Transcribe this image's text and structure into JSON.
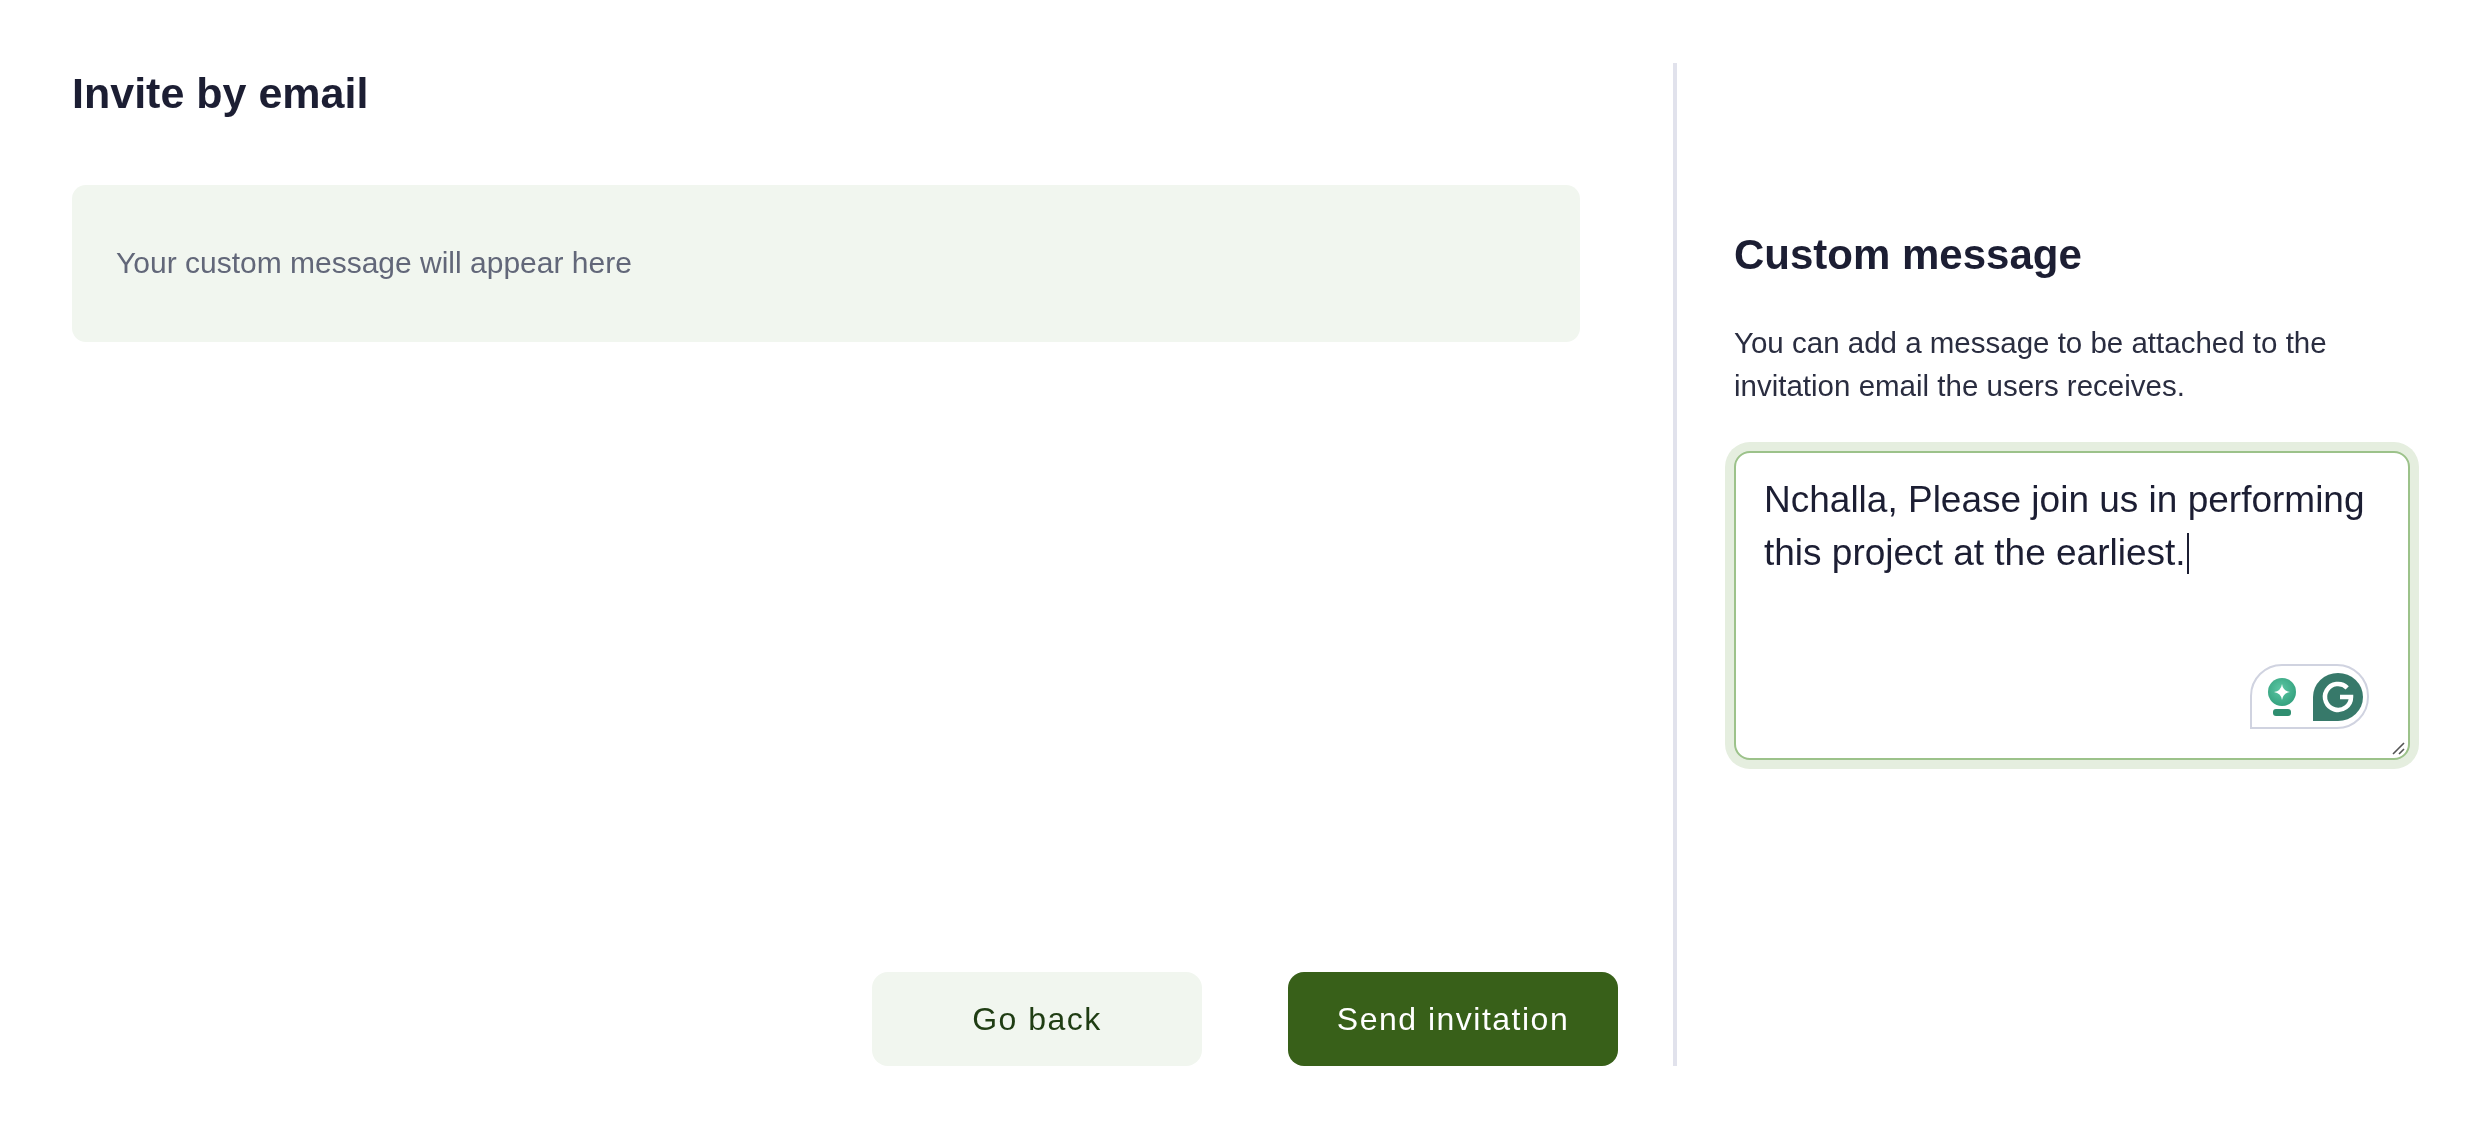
{
  "invite_panel": {
    "title": "Invite by email",
    "preview": {
      "text": "Your custom message will appear here"
    },
    "buttons": [
      {
        "label": "Go back",
        "kind": "secondary"
      },
      {
        "label": "Send invitation",
        "kind": "primary"
      }
    ]
  },
  "custom_message": {
    "title": "Custom message",
    "description": "You can add a message to be attached to the invitation email the users receives.",
    "textarea": {
      "value": "Nchalla, Please join us in performing this project at the earliest.",
      "focused": true
    }
  }
}
